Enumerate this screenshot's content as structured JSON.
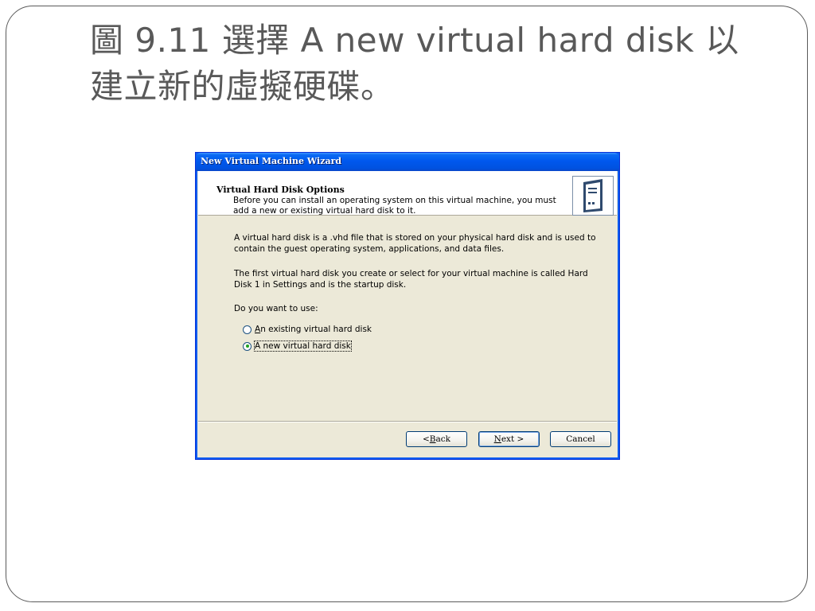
{
  "slide": {
    "title_line1": "圖 9.11 選擇 A new virtual hard disk 以",
    "title_line2": "建立新的虛擬硬碟。"
  },
  "dialog": {
    "title": "New Virtual Machine Wizard",
    "header": {
      "title": "Virtual Hard Disk Options",
      "description": "Before you can install an operating system on this virtual machine, you must add a new or existing virtual hard disk to it.",
      "icon": "hard-disk-icon"
    },
    "body": {
      "paragraph1": "A virtual hard disk is a .vhd file that is stored on your physical hard disk and is used to contain the guest operating system, applications, and data files.",
      "paragraph2": "The first virtual hard disk you create or select for your virtual machine is called Hard Disk 1 in Settings and is the startup disk.",
      "question": "Do you want to use:"
    },
    "options": [
      {
        "mnemonic": "A",
        "rest": "n existing virtual hard disk",
        "selected": false
      },
      {
        "mnemonic": "",
        "rest": "A new virtual hard disk",
        "selected": true
      }
    ],
    "buttons": {
      "back_prefix": "< ",
      "back_mnemonic": "B",
      "back_rest": "ack",
      "next_mnemonic": "N",
      "next_rest": "ext >",
      "cancel": "Cancel"
    }
  },
  "colors": {
    "titlebar": "#0058ee",
    "dialog_bg": "#ece9d8",
    "slide_text": "#595959",
    "radio_dot": "#21a121"
  }
}
